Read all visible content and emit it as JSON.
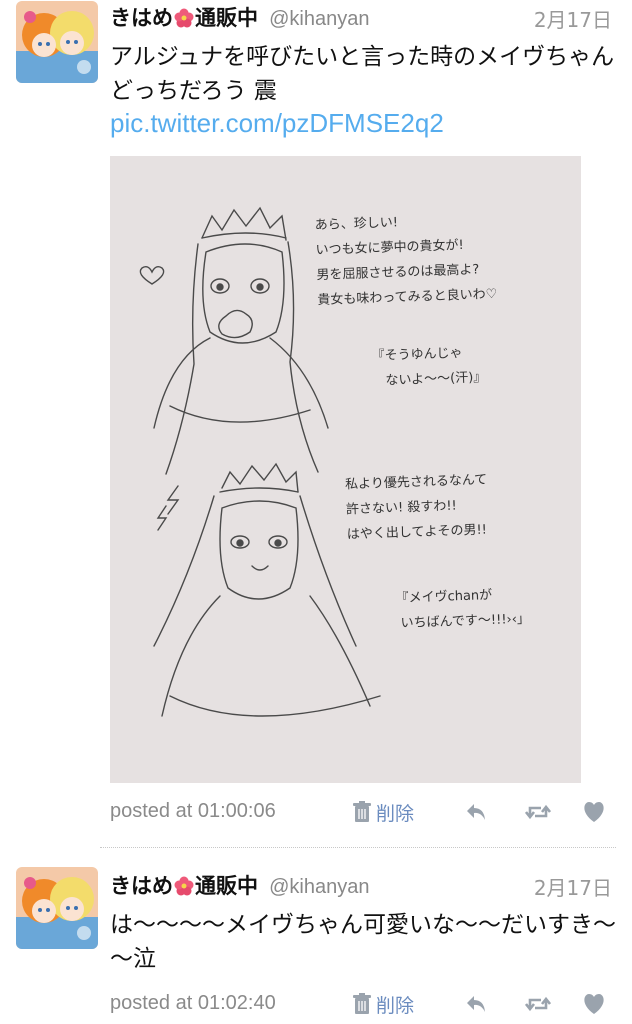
{
  "tweets": [
    {
      "name": "きはめ",
      "name_suffix": "通販中",
      "handle": "@kihanyan",
      "date": "2月17日",
      "text": "アルジュナを呼びたいと言った時のメイヴちゃん どっちだろう 震",
      "link": "pic.twitter.com/pzDFMSE2q2",
      "posted": "posted at 01:00:06",
      "delete_label": "削除"
    },
    {
      "name": "きはめ",
      "name_suffix": "通販中",
      "handle": "@kihanyan",
      "date": "2月17日",
      "text": "は～～～～メイヴちゃん可愛いな～～だいすき～～泣",
      "posted": "posted at 01:02:40",
      "delete_label": "削除"
    }
  ],
  "sketch_notes": {
    "top_speech": "あら、珍しい!\nいつも女に夢中の貴女が!\n男を屈服させるのは最高よ?\n貴女も味わってみると良いわ♡",
    "top_aside": "『そうゆんじゃ\n　ないよ～～(汗)』",
    "bottom_speech": "私より優先されるなんて\n許さない! 殺すわ!!\nはやく出してよその男!!",
    "bottom_aside": "『メイヴchanが\n いちばんです～!!!›‹」"
  },
  "colors": {
    "link": "#55acee",
    "delete": "#6b8cbf",
    "muted": "#8a8a8a",
    "icon": "#9aa3ad"
  }
}
